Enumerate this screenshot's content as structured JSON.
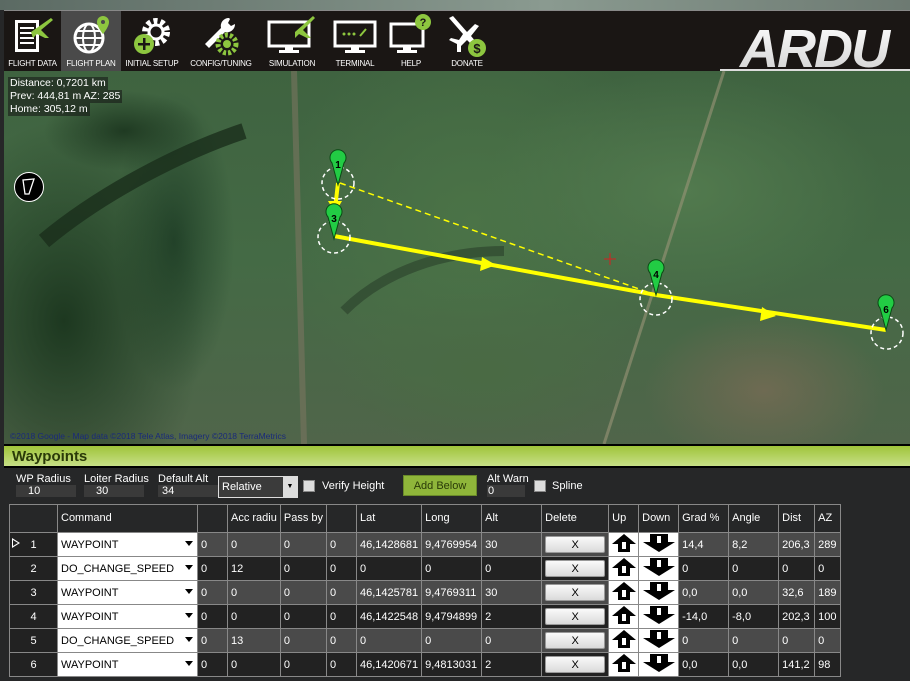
{
  "toolbar": {
    "items": [
      {
        "label": "FLIGHT DATA",
        "icon": "flight-data-icon",
        "active": false
      },
      {
        "label": "FLIGHT PLAN",
        "icon": "flight-plan-icon",
        "active": true
      },
      {
        "label": "INITIAL SETUP",
        "icon": "initial-setup-icon",
        "active": false
      },
      {
        "label": "CONFIG/TUNING",
        "icon": "config-tuning-icon",
        "active": false
      },
      {
        "label": "SIMULATION",
        "icon": "simulation-icon",
        "active": false
      },
      {
        "label": "TERMINAL",
        "icon": "terminal-icon",
        "active": false
      },
      {
        "label": "HELP",
        "icon": "help-icon",
        "active": false
      },
      {
        "label": "DONATE",
        "icon": "donate-icon",
        "active": false
      }
    ],
    "logo_text": "ARDU",
    "accent": "#8dc63f"
  },
  "map": {
    "info": {
      "distance": "Distance: 0,7201 km",
      "prev": "Prev: 444,81 m AZ: 285",
      "home": "Home: 305,12 m"
    },
    "attribution": "©2018 Google - Map data ©2018 Tele Atlas, Imagery ©2018 TerraMetrics",
    "markers": [
      "1",
      "3",
      "4",
      "6"
    ],
    "route_color": "#ffff00",
    "marker_color": "#22cc44"
  },
  "waypoints": {
    "title": "Waypoints",
    "wp_radius_label": "WP Radius",
    "wp_radius": "10",
    "loiter_radius_label": "Loiter Radius",
    "loiter_radius": "30",
    "default_alt_label": "Default Alt",
    "default_alt": "34",
    "frame": "Relative",
    "verify_height_label": "Verify Height",
    "verify_height_checked": false,
    "add_below_label": "Add Below",
    "alt_warn_label": "Alt Warn",
    "alt_warn": "0",
    "spline_label": "Spline",
    "spline_checked": false,
    "columns": [
      "",
      "Command",
      "",
      "Acc radiu",
      "Pass by",
      "",
      "Lat",
      "Long",
      "Alt",
      "Delete",
      "Up",
      "Down",
      "Grad %",
      "Angle",
      "Dist",
      "AZ"
    ],
    "delete_label": "X",
    "rows": [
      {
        "n": "1",
        "command": "WAYPOINT",
        "p1": "0",
        "p2": "0",
        "p3": "0",
        "p4": "0",
        "lat": "46,1428681",
        "long": "9,4769954",
        "alt": "30",
        "grad": "14,4",
        "angle": "8,2",
        "dist": "206,3",
        "az": "289",
        "current": true
      },
      {
        "n": "2",
        "command": "DO_CHANGE_SPEED",
        "p1": "0",
        "p2": "12",
        "p3": "0",
        "p4": "0",
        "lat": "0",
        "long": "0",
        "alt": "0",
        "grad": "0",
        "angle": "0",
        "dist": "0",
        "az": "0"
      },
      {
        "n": "3",
        "command": "WAYPOINT",
        "p1": "0",
        "p2": "0",
        "p3": "0",
        "p4": "0",
        "lat": "46,1425781",
        "long": "9,4769311",
        "alt": "30",
        "grad": "0,0",
        "angle": "0,0",
        "dist": "32,6",
        "az": "189"
      },
      {
        "n": "4",
        "command": "WAYPOINT",
        "p1": "0",
        "p2": "0",
        "p3": "0",
        "p4": "0",
        "lat": "46,1422548",
        "long": "9,4794899",
        "alt": "2",
        "grad": "-14,0",
        "angle": "-8,0",
        "dist": "202,3",
        "az": "100"
      },
      {
        "n": "5",
        "command": "DO_CHANGE_SPEED",
        "p1": "0",
        "p2": "13",
        "p3": "0",
        "p4": "0",
        "lat": "0",
        "long": "0",
        "alt": "0",
        "grad": "0",
        "angle": "0",
        "dist": "0",
        "az": "0"
      },
      {
        "n": "6",
        "command": "WAYPOINT",
        "p1": "0",
        "p2": "0",
        "p3": "0",
        "p4": "0",
        "lat": "46,1420671",
        "long": "9,4813031",
        "alt": "2",
        "grad": "0,0",
        "angle": "0,0",
        "dist": "141,2",
        "az": "98"
      }
    ]
  }
}
